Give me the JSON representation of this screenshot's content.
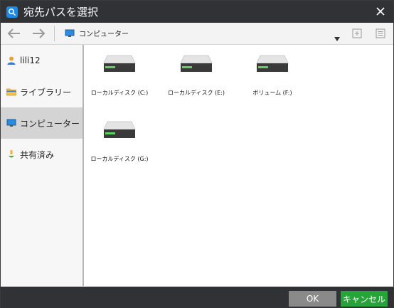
{
  "window": {
    "title": "宛先パスを選択"
  },
  "toolbar": {
    "path_label": "コンピューター"
  },
  "sidebar": {
    "items": [
      {
        "label": "lili12",
        "icon": "user-icon"
      },
      {
        "label": "ライブラリー",
        "icon": "folder-icon"
      },
      {
        "label": "コンピューター",
        "icon": "monitor-icon",
        "selected": true
      },
      {
        "label": "共有済み",
        "icon": "share-icon"
      }
    ]
  },
  "drives": [
    {
      "label": "ローカルディスク (C:)"
    },
    {
      "label": "ローカルディスク (E:)"
    },
    {
      "label": "ボリューム (F:)"
    },
    {
      "label": "ローカルディスク (G:)"
    }
  ],
  "buttons": {
    "ok": "OK",
    "cancel": "キャンセル"
  },
  "colors": {
    "titlebar": "#303236",
    "ok_button": "#8a8a8a",
    "cancel_button": "#27a33a",
    "app_icon": "#1e88e5"
  }
}
